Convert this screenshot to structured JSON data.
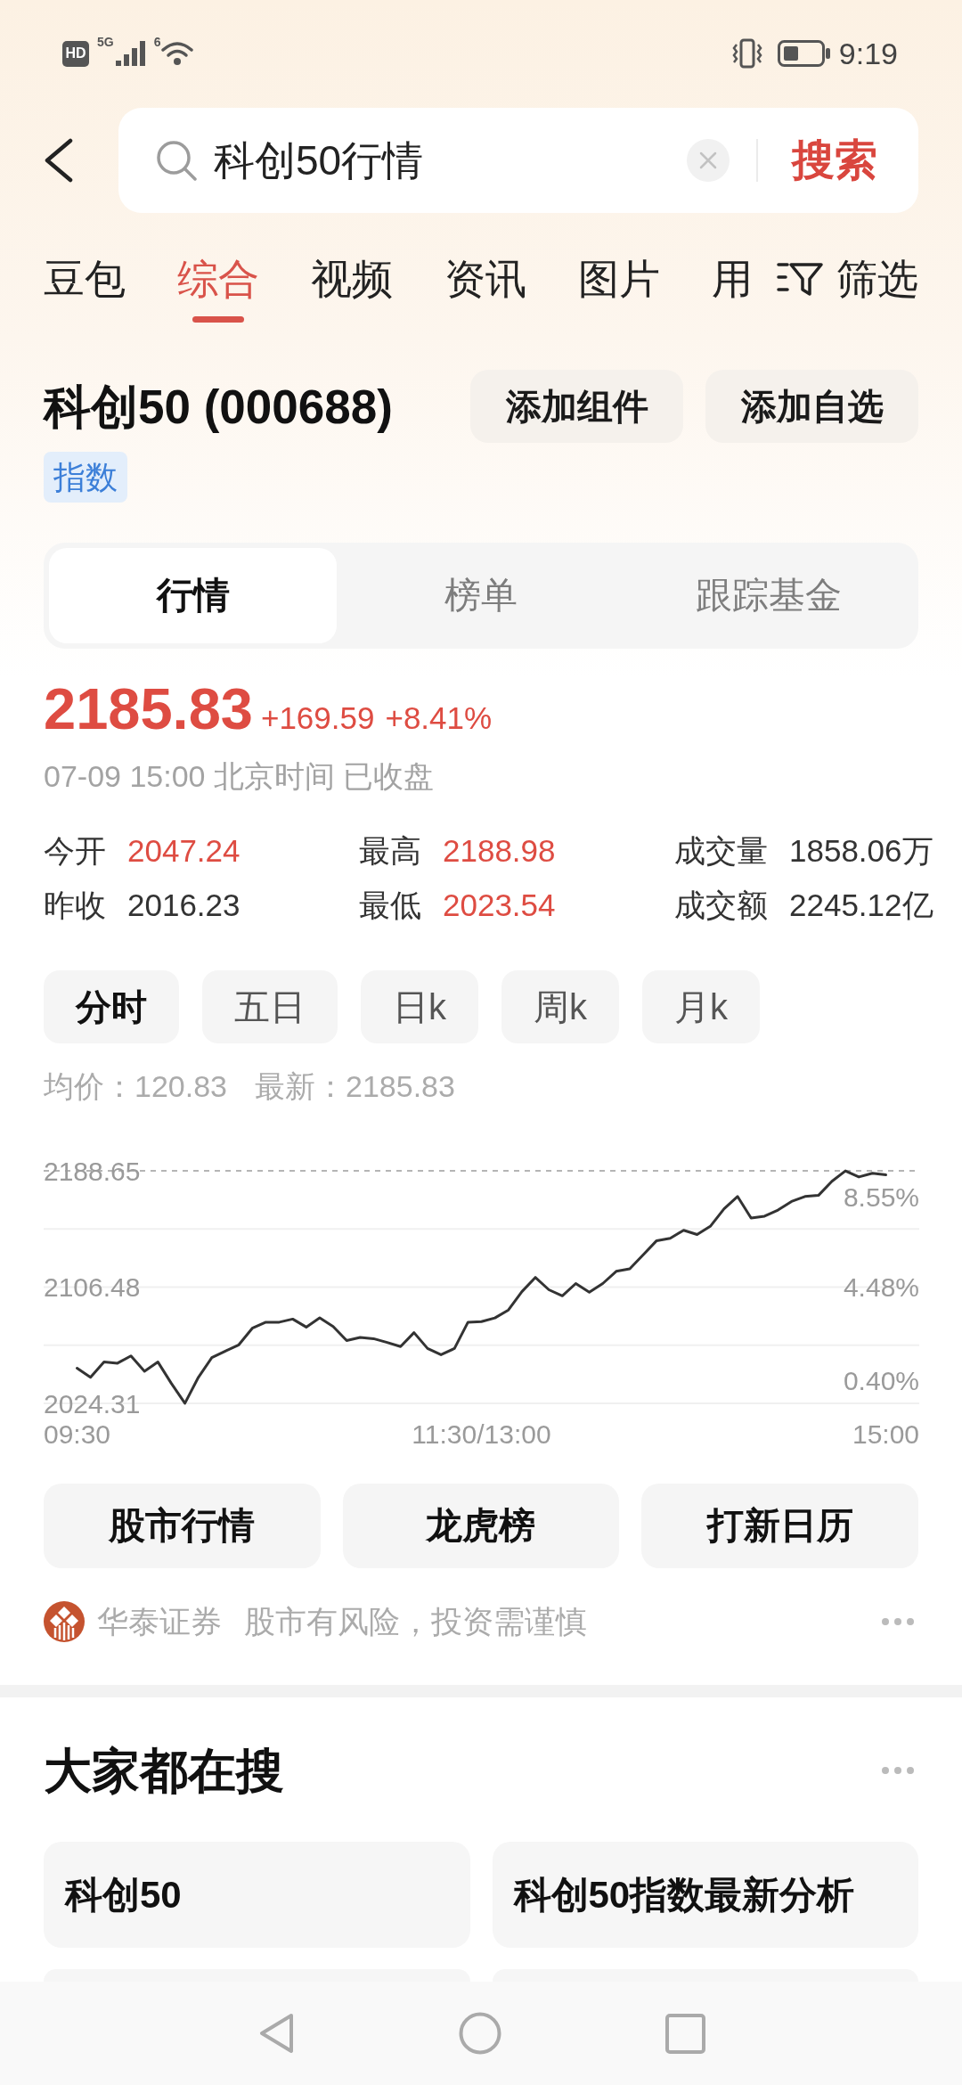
{
  "status_bar": {
    "hd": "HD",
    "network": "5G",
    "wifi_band": "6",
    "time": "9:19"
  },
  "search": {
    "value": "科创50行情",
    "button": "搜索"
  },
  "tabs": [
    {
      "label": "豆包",
      "selected": false
    },
    {
      "label": "综合",
      "selected": true
    },
    {
      "label": "视频",
      "selected": false
    },
    {
      "label": "资讯",
      "selected": false
    },
    {
      "label": "图片",
      "selected": false
    },
    {
      "label": "用",
      "selected": false
    }
  ],
  "filter": {
    "label": "筛选"
  },
  "stock": {
    "title": "科创50 (000688)",
    "actions": [
      "添加组件",
      "添加自选"
    ],
    "badge": "指数"
  },
  "segments": [
    {
      "label": "行情",
      "selected": true
    },
    {
      "label": "榜单",
      "selected": false
    },
    {
      "label": "跟踪基金",
      "selected": false
    }
  ],
  "quote": {
    "price": "2185.83",
    "change": "+169.59",
    "change_percent": "+8.41%",
    "timestamp": "07-09 15:00 北京时间 已收盘"
  },
  "stats": [
    {
      "label": "今开",
      "value": "2047.24",
      "color": "#de4c42"
    },
    {
      "label": "最高",
      "value": "2188.98",
      "color": "#de4c42"
    },
    {
      "label": "成交量",
      "value": "1858.06万",
      "color": "#333333"
    },
    {
      "label": "昨收",
      "value": "2016.23",
      "color": "#333333"
    },
    {
      "label": "最低",
      "value": "2023.54",
      "color": "#de4c42"
    },
    {
      "label": "成交额",
      "value": "2245.12亿",
      "color": "#333333"
    }
  ],
  "periods": [
    {
      "label": "分时",
      "selected": true
    },
    {
      "label": "五日",
      "selected": false
    },
    {
      "label": "日k",
      "selected": false
    },
    {
      "label": "周k",
      "selected": false
    },
    {
      "label": "月k",
      "selected": false
    }
  ],
  "chart_info": [
    "均价：120.83",
    "最新：2185.83"
  ],
  "chart": {
    "chart_data": {
      "type": "line",
      "categories": [
        "09:30",
        null,
        null,
        null,
        null,
        null,
        null,
        null,
        null,
        null,
        null,
        null,
        null,
        null,
        null,
        null,
        null,
        null,
        null,
        null,
        null,
        null,
        null,
        null,
        null,
        null,
        null,
        null,
        null,
        null,
        "11:30/13:00",
        null,
        null,
        null,
        null,
        null,
        null,
        null,
        null,
        null,
        null,
        null,
        null,
        null,
        null,
        null,
        null,
        null,
        null,
        null,
        null,
        null,
        null,
        null,
        null,
        null,
        null,
        null,
        null,
        null,
        "15:00"
      ],
      "series": [
        {
          "color": "#333333",
          "values": [
            2049.2,
            2042.7,
            2053.5,
            2052.7,
            2057.9,
            2047.0,
            2053.5,
            2038.4,
            2024.4,
            2042.7,
            2056.6,
            2061.3,
            2065.7,
            2077.4,
            2081.7,
            2081.7,
            2083.9,
            2078.2,
            2084.7,
            2078.6,
            2068.7,
            2070.9,
            2070.0,
            2067.4,
            2064.4,
            2074.3,
            2063.1,
            2058.7,
            2063.1,
            2081.7,
            2082.1,
            2084.7,
            2090.3,
            2103.3,
            2113.3,
            2104.6,
            2100.3,
            2109.0,
            2102.9,
            2109.0,
            2117.6,
            2119.4,
            2129.3,
            2139.3,
            2141.0,
            2146.6,
            2143.6,
            2149.7,
            2161.8,
            2170.5,
            2155.3,
            2156.6,
            2160.9,
            2167.0,
            2170.5,
            2171.3,
            2181.3,
            2188.6,
            2184.3,
            2186.9,
            2185.8
          ]
        }
      ],
      "ylim": [
        2024.31,
        2188.65
      ],
      "yticks": [
        2188.65,
        2106.48,
        2024.31
      ]
    },
    "right_axis_labels": [
      "8.55%",
      "4.48%",
      "0.40%"
    ]
  },
  "quick_links": [
    "股市行情",
    "龙虎榜",
    "打新日历"
  ],
  "source": {
    "name": "华泰证券",
    "notice": "股市有风险，投资需谨慎"
  },
  "hot_searches": {
    "title": "大家都在搜",
    "items": [
      "科创50",
      "科创50指数最新分析"
    ]
  }
}
